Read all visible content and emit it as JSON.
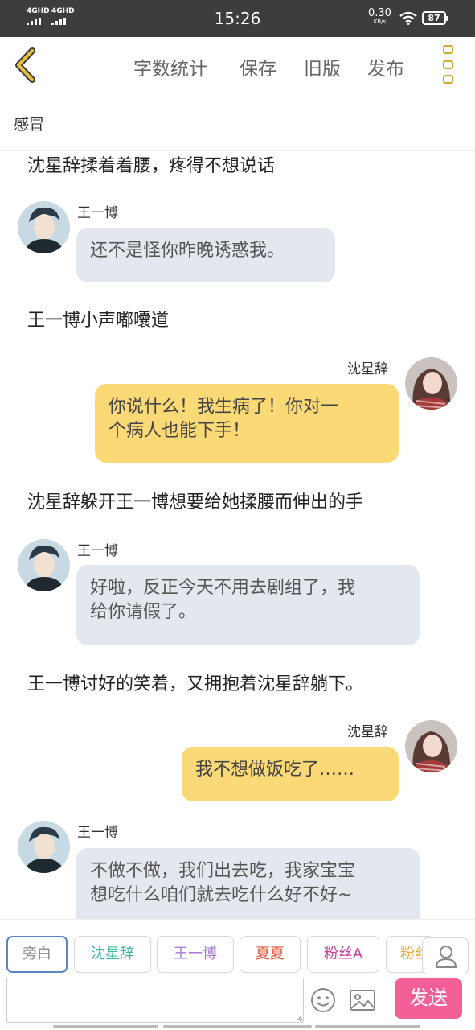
{
  "status_bar": {
    "signal1": "4GHD",
    "signal2": "4GHD",
    "time": "15:26",
    "speed_value": "0.30",
    "speed_unit": "KB/s",
    "battery": "87"
  },
  "toolbar": {
    "actions": [
      "字数统计",
      "保存",
      "旧版",
      "发布"
    ]
  },
  "title": "感冒",
  "chat": {
    "narration": [
      "沈星辞揉着着腰，疼得不想说话",
      "王一博小声嘟囔道",
      "沈星辞躲开王一博想要给她揉腰而伸出的手",
      "王一博讨好的笑着，又拥抱着沈星辞躺下。"
    ],
    "messages": [
      {
        "sender": "王一博",
        "lines": [
          "还不是怪你昨晚诱惑我。"
        ]
      },
      {
        "sender": "沈星辞",
        "lines": [
          "你说什么！我生病了！你对一",
          "个病人也能下手！"
        ]
      },
      {
        "sender": "王一博",
        "lines": [
          "好啦，反正今天不用去剧组了，我",
          "给你请假了。"
        ]
      },
      {
        "sender": "沈星辞",
        "lines": [
          "我不想做饭吃了……"
        ]
      },
      {
        "sender": "王一博",
        "lines": [
          "不做不做，我们出去吃，我家宝宝",
          "想吃什么咱们就去吃什么好不好~"
        ]
      }
    ]
  },
  "roles": [
    {
      "label": "旁白",
      "color": "#888888"
    },
    {
      "label": "沈星辞",
      "color": "#3bb6a5"
    },
    {
      "label": "王一博",
      "color": "#a97ad6"
    },
    {
      "label": "夏夏",
      "color": "#e0553a"
    },
    {
      "label": "粉丝A",
      "color": "#c9409b"
    },
    {
      "label": "粉丝",
      "color": "#f0a93c"
    }
  ],
  "input": {
    "placeholder": "",
    "send_label": "发送"
  },
  "colors": {
    "accent": "#d4a72c",
    "left_bubble": "#e3e8ef",
    "right_bubble": "#fbd976",
    "send_button": "#f35f97"
  }
}
